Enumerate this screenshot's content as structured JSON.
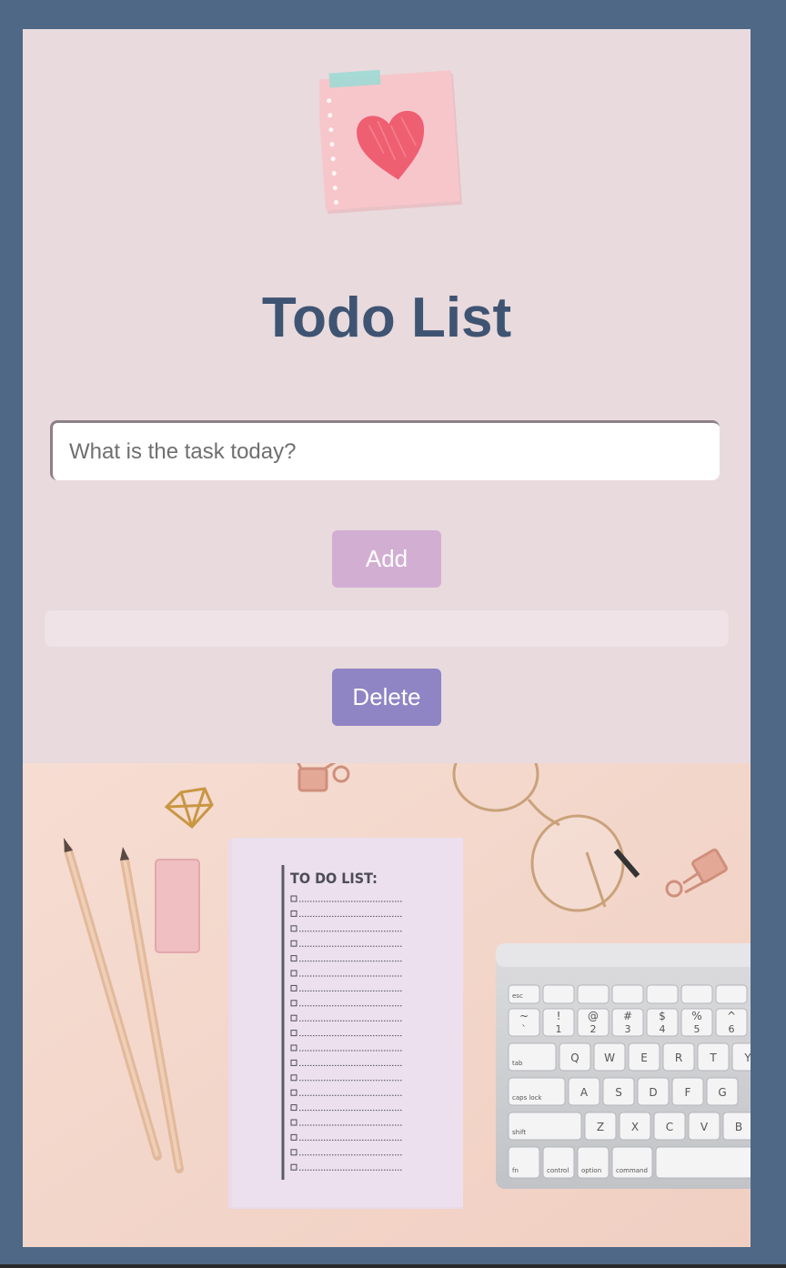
{
  "app": {
    "title": "Todo List",
    "input_placeholder": "What is the task today?",
    "input_value": "",
    "add_label": "Add",
    "delete_label": "Delete",
    "tasks": []
  },
  "photo": {
    "notepad_heading": "TO DO LIST:",
    "keys_row1": [
      "esc",
      "",
      "",
      "",
      "",
      "",
      ""
    ],
    "keys_row2": [
      "~",
      "!",
      "@",
      "#",
      "$",
      "%",
      "^"
    ],
    "keys_row2_sub": [
      "`",
      "1",
      "2",
      "3",
      "4",
      "5",
      "6"
    ],
    "keys_row3": [
      "tab",
      "Q",
      "W",
      "E",
      "R",
      "T",
      "Y"
    ],
    "keys_row4": [
      "caps lock",
      "A",
      "S",
      "D",
      "F",
      "G"
    ],
    "keys_row5": [
      "shift",
      "Z",
      "X",
      "C",
      "V",
      "B"
    ],
    "keys_row6": [
      "fn",
      "control",
      "option",
      "command"
    ]
  },
  "colors": {
    "background": "#4e6886",
    "card": "#e8dadd",
    "title": "#3f5472",
    "add_button": "#d3aed3",
    "delete_button": "#8f84c4",
    "heart": "#ef5f72",
    "sticky_note": "#f7c6cb"
  },
  "icons": {
    "header": "sticky-note-heart-icon"
  }
}
